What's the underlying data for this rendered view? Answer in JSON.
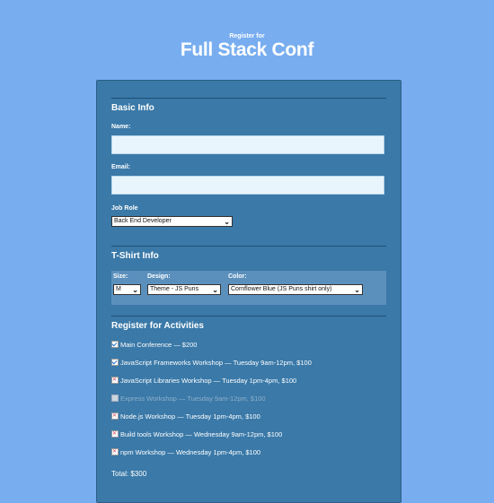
{
  "header": {
    "subtitle": "Register for",
    "title": "Full Stack Conf"
  },
  "basic_info": {
    "heading": "Basic Info",
    "name_label": "Name:",
    "name_value": "",
    "email_label": "Email:",
    "email_value": "",
    "job_role_label": "Job Role",
    "job_role_selected": "Back End Developer"
  },
  "tshirt": {
    "heading": "T-Shirt Info",
    "size_label": "Size:",
    "size_selected": "M",
    "design_label": "Design:",
    "design_selected": "Theme - JS Puns",
    "color_label": "Color:",
    "color_selected": "Cornflower Blue (JS Puns shirt only)"
  },
  "activities": {
    "heading": "Register for Activities",
    "items": [
      {
        "label": "Main Conference — $200",
        "checked": true,
        "disabled": false
      },
      {
        "label": "JavaScript Frameworks Workshop — Tuesday 9am-12pm, $100",
        "checked": true,
        "disabled": false
      },
      {
        "label": "JavaScript Libraries Workshop — Tuesday 1pm-4pm, $100",
        "checked": false,
        "disabled": false
      },
      {
        "label": "Express Workshop — Tuesday 9am-12pm, $100",
        "checked": false,
        "disabled": true
      },
      {
        "label": "Node.js Workshop — Tuesday 1pm-4pm, $100",
        "checked": false,
        "disabled": false
      },
      {
        "label": "Build tools Workshop — Wednesday 9am-12pm, $100",
        "checked": false,
        "disabled": false
      },
      {
        "label": "npm Workshop — Wednesday 1pm-4pm, $100",
        "checked": false,
        "disabled": false
      }
    ],
    "total": "Total: $300"
  },
  "colors": {
    "page_bg": "#78aef0",
    "form_bg": "#3a79a8",
    "tee_box_bg": "#5b90bd",
    "input_bg": "#e9f5fc"
  }
}
